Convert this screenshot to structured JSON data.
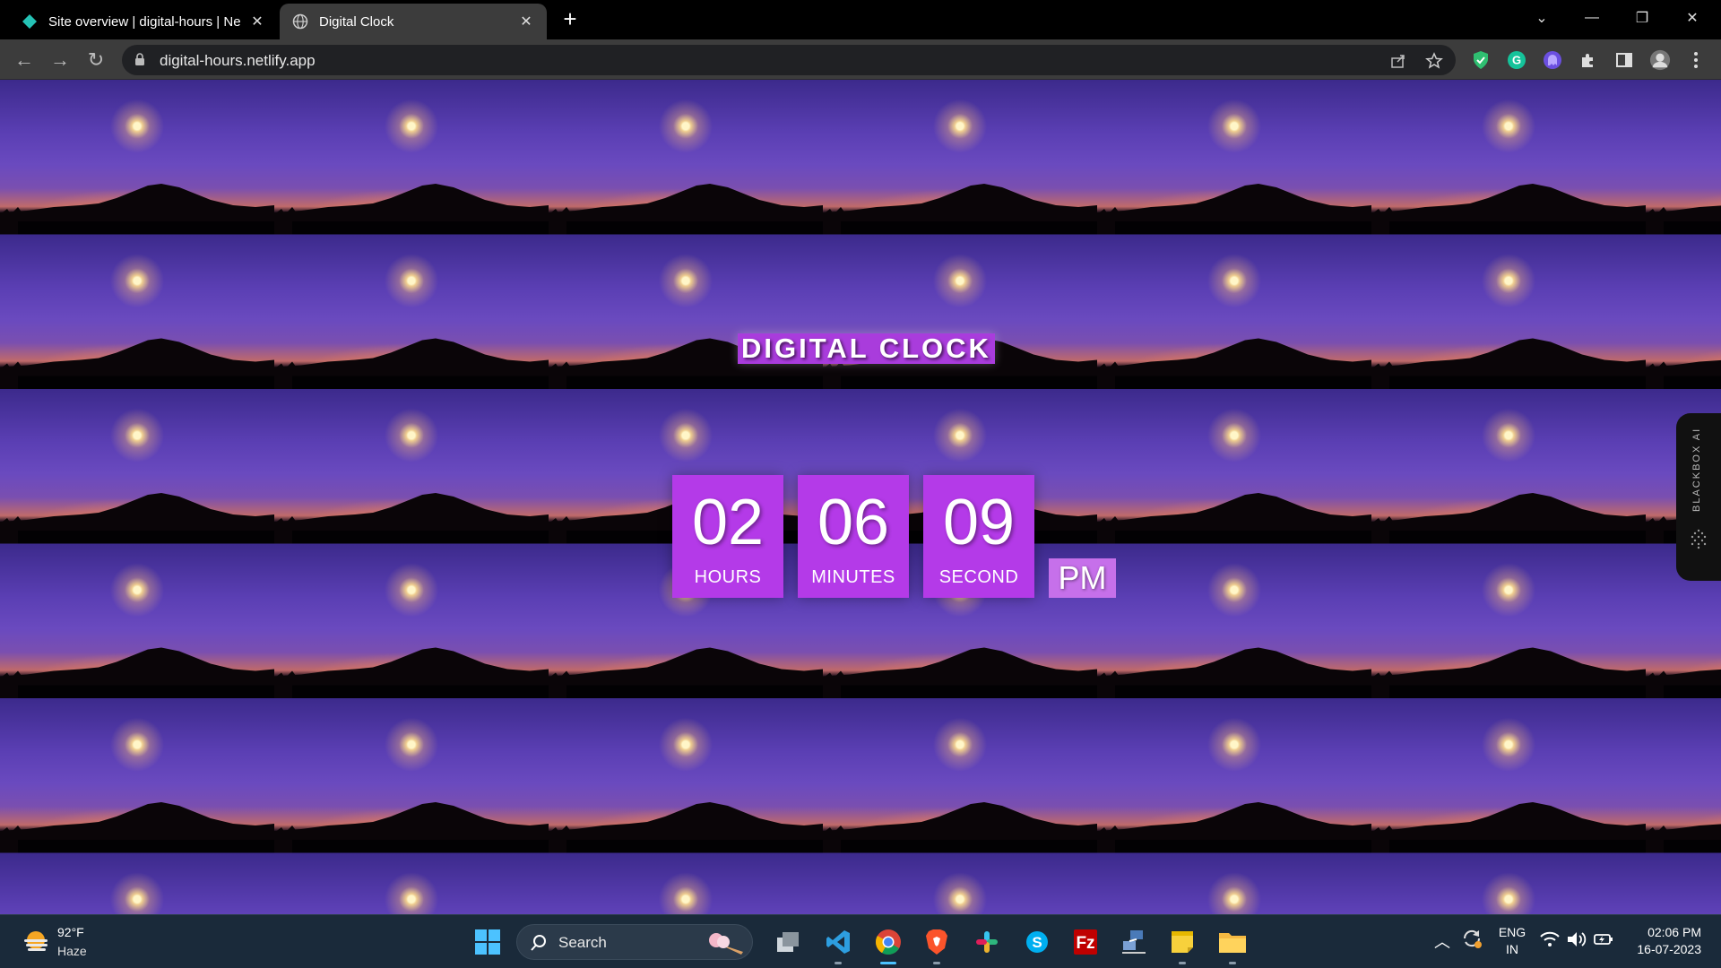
{
  "browser": {
    "tabs": [
      {
        "title": "Site overview | digital-hours | Ne",
        "active": false,
        "favicon": "netlify-icon"
      },
      {
        "title": "Digital Clock",
        "active": true,
        "favicon": "globe-icon"
      }
    ],
    "url": "digital-hours.netlify.app"
  },
  "clock": {
    "heading": "DIGITAL CLOCK",
    "hours": "02",
    "hours_label": "HOURS",
    "minutes": "06",
    "minutes_label": "MINUTES",
    "seconds": "09",
    "seconds_label": "SECOND",
    "ampm": "PM"
  },
  "sidebar_widget": {
    "label": "BLACKBOX AI"
  },
  "taskbar": {
    "weather": {
      "temp": "92°F",
      "desc": "Haze"
    },
    "search_label": "Search",
    "language": {
      "line1": "ENG",
      "line2": "IN"
    },
    "time": "02:06 PM",
    "date": "16-07-2023"
  },
  "colors": {
    "accent_purple": "#b43ae8",
    "ampm_purple": "#c670ea",
    "chrome_dark": "#3c3c3c",
    "taskbar": "#1a2a3a"
  }
}
